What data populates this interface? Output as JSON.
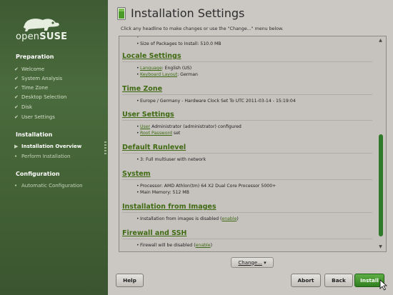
{
  "sidebar": {
    "logo_text_pre": "open",
    "logo_text_bold": "SUSE",
    "sections": [
      {
        "title": "Preparation",
        "steps": [
          {
            "label": "Welcome",
            "state": "done"
          },
          {
            "label": "System Analysis",
            "state": "done"
          },
          {
            "label": "Time Zone",
            "state": "done"
          },
          {
            "label": "Desktop Selection",
            "state": "done"
          },
          {
            "label": "Disk",
            "state": "done"
          },
          {
            "label": "User Settings",
            "state": "done"
          }
        ]
      },
      {
        "title": "Installation",
        "steps": [
          {
            "label": "Installation Overview",
            "state": "current"
          },
          {
            "label": "Perform Installation",
            "state": "pending"
          }
        ]
      },
      {
        "title": "Configuration",
        "steps": [
          {
            "label": "Automatic Configuration",
            "state": "pending"
          }
        ]
      }
    ]
  },
  "main": {
    "title": "Installation Settings",
    "subtitle": "Click any headline to make changes or use the \"Change...\" menu below.",
    "top_items": [
      {
        "text": "Size of Packages to Install: 510.0 MB"
      }
    ],
    "sections": [
      {
        "heading": "Locale Settings",
        "items": [
          {
            "link": "Language",
            "text": ": English (US)"
          },
          {
            "link": "Keyboard Layout",
            "text": ": German"
          }
        ]
      },
      {
        "heading": "Time Zone",
        "items": [
          {
            "link": "",
            "text": "Europe / Germany - Hardware Clock Set To UTC 2011-03-14 - 15:19:04"
          }
        ]
      },
      {
        "heading": "User Settings",
        "items": [
          {
            "link": "User",
            "text": " Administrator (administrator) configured"
          },
          {
            "link": "Root Password",
            "text": " set"
          }
        ]
      },
      {
        "heading": "Default Runlevel",
        "items": [
          {
            "link": "",
            "text": "3: Full multiuser with network"
          }
        ]
      },
      {
        "heading": "System",
        "items": [
          {
            "link": "",
            "text": "Processor: AMD Athlon(tm) 64 X2 Dual Core Processor 5000+"
          },
          {
            "link": "",
            "text": "Main Memory: 512 MB"
          }
        ]
      },
      {
        "heading": "Installation from Images",
        "items": [
          {
            "link": "",
            "text": "Installation from images is disabled (",
            "link_after": "enable",
            "text_after": ")"
          }
        ]
      },
      {
        "heading": "Firewall and SSH",
        "items": [
          {
            "link": "",
            "text": "Firewall will be disabled (",
            "link_after": "enable",
            "text_after": ")"
          }
        ]
      }
    ],
    "change_button": {
      "label": "Change...",
      "arrow": "▾"
    },
    "buttons": {
      "help": "Help",
      "abort": "Abort",
      "back": "Back",
      "install": "Install"
    }
  },
  "colors": {
    "sidebar_green": "#446336",
    "link_green": "#3f6a12",
    "install_green": "#2f7f20",
    "scroll_thumb": "#2f7a2a"
  },
  "icons": {
    "title_icon": "document-green-icon",
    "done_step": "checkmark-icon",
    "current_step": "arrow-right-icon",
    "pending_step": "bullet-icon",
    "change_dropdown": "chevron-down-icon",
    "scroll_up": "arrow-up-icon",
    "scroll_down": "arrow-down-icon"
  }
}
